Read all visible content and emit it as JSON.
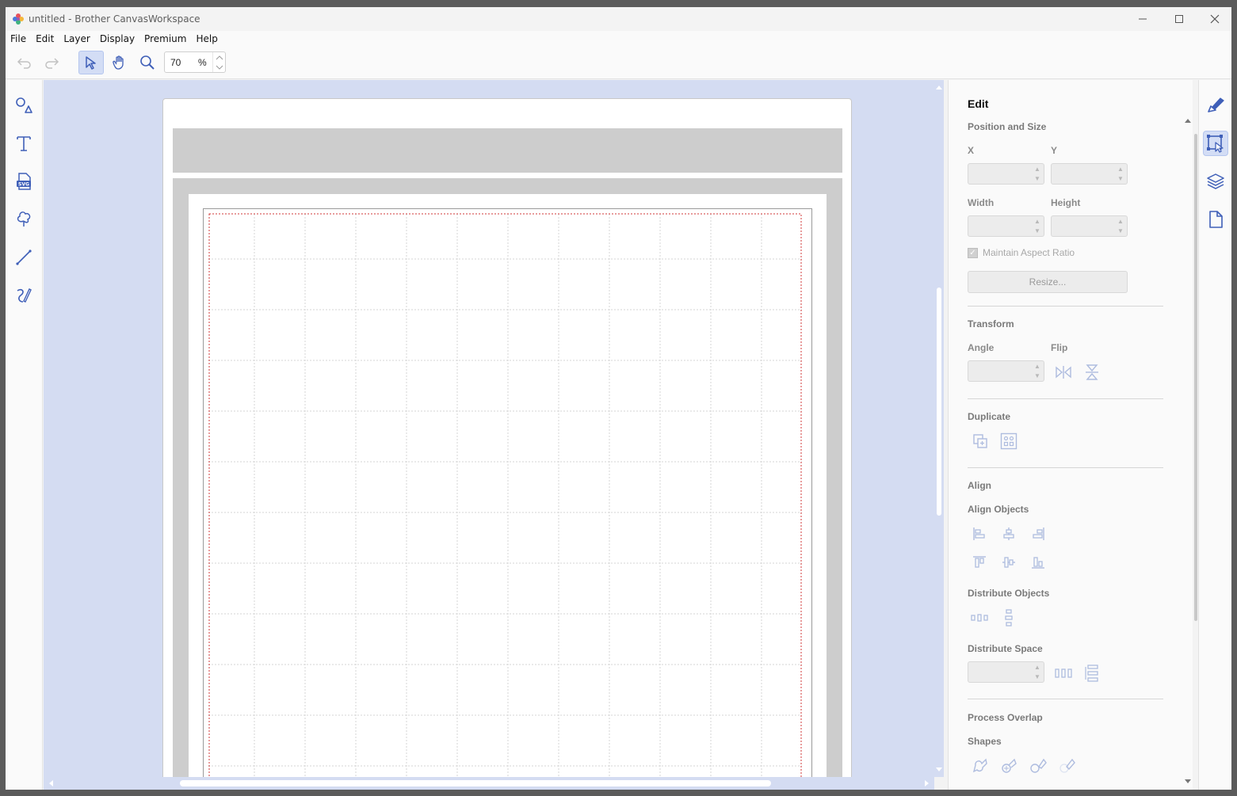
{
  "window": {
    "title": "untitled - Brother CanvasWorkspace"
  },
  "menu": [
    "File",
    "Edit",
    "Layer",
    "Display",
    "Premium",
    "Help"
  ],
  "toolbar": {
    "zoom_value": "70",
    "zoom_unit": "%"
  },
  "panel": {
    "title": "Edit",
    "position_size": {
      "heading": "Position and Size",
      "x_label": "X",
      "y_label": "Y",
      "width_label": "Width",
      "height_label": "Height",
      "maintain_aspect": "Maintain Aspect Ratio",
      "resize_button": "Resize..."
    },
    "transform": {
      "heading": "Transform",
      "angle_label": "Angle",
      "flip_label": "Flip"
    },
    "duplicate": {
      "heading": "Duplicate"
    },
    "align": {
      "heading": "Align",
      "align_objects": "Align Objects",
      "distribute_objects": "Distribute Objects",
      "distribute_space": "Distribute Space"
    },
    "process_overlap": {
      "heading": "Process Overlap",
      "shapes_label": "Shapes"
    }
  },
  "colors": {
    "accent": "#3f5fb8",
    "canvas_bg": "#d4dcf2",
    "active_bg": "#d3ddf5"
  }
}
